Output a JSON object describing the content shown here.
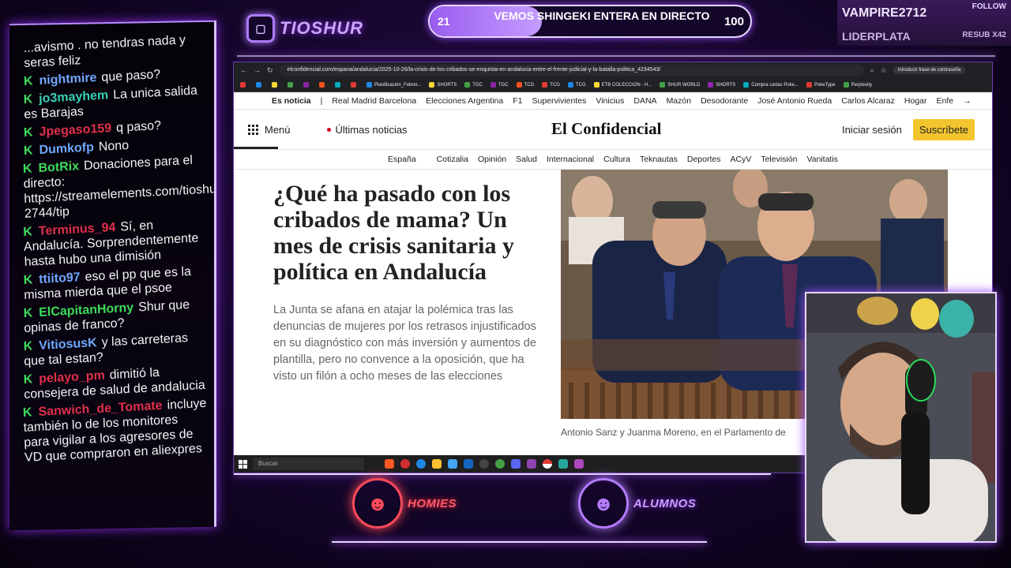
{
  "channel": {
    "name": "TIOSHUR"
  },
  "goal": {
    "current": "21",
    "target": "100",
    "title": "VEMOS SHINGEKI ENTERA EN DIRECTO",
    "progress": 0.21
  },
  "sub_alert": {
    "user": "VAMPIRE2712",
    "follow_label": "FOLLOW",
    "tier": "LIDERPLATA",
    "resub": "RESUB X42"
  },
  "chat": [
    {
      "user": "",
      "color": "",
      "text": "...avismo . no tendras nada y seras feliz",
      "badge": false
    },
    {
      "user": "nightmire",
      "color": "#6fa8ff",
      "text": "que paso?",
      "badge": true
    },
    {
      "user": "jo3mayhem",
      "color": "#3ad0b4",
      "text": "La unica salida es Barajas",
      "badge": true
    },
    {
      "user": "Jpegaso159",
      "color": "#e0304a",
      "text": "q paso?",
      "badge": true
    },
    {
      "user": "Dumkofp",
      "color": "#6fa8ff",
      "text": "Nono",
      "badge": true
    },
    {
      "user": "BotRix",
      "color": "#3ddc5a",
      "text": "Donaciones para el directo: https://streamelements.com/tioshur-2744/tip",
      "badge": true
    },
    {
      "user": "Terminus_94",
      "color": "#e0304a",
      "text": "Sí, en Andalucía. Sorprendentemente hasta hubo una dimisión",
      "badge": true
    },
    {
      "user": "ttiito97",
      "color": "#6fa8ff",
      "text": "eso el pp que es la misma mierda que el psoe",
      "badge": true
    },
    {
      "user": "ElCapitanHorny",
      "color": "#3ddc5a",
      "text": "Shur que opinas de franco?",
      "badge": true
    },
    {
      "user": "VitiosusK",
      "color": "#6fa8ff",
      "text": "y las carreteras que tal estan?",
      "badge": true
    },
    {
      "user": "pelayo_pm",
      "color": "#e0304a",
      "text": "dimitió la consejera de salud de andalucia",
      "badge": true
    },
    {
      "user": "Sanwich_de_Tomate",
      "color": "#e0304a",
      "text": "incluye también lo de los monitores para vigilar a los agresores de VD que compraron en aliexpres",
      "badge": true
    }
  ],
  "browser": {
    "url": "elconfidencial.com/espana/andalucia/2025-10-26/la-crisis-de-los-cribados-se-enquista-en-andalucia-entre-el-frente-judicial-y-la-batalla-politica_4234543/",
    "ext_button": "Introducir frase de contraseña",
    "bookmarks": [
      "Planificación_Febrer...",
      "SHORTS",
      "TGC",
      "TGC",
      "TCG",
      "TCG",
      "TCG",
      "ETB COLECCION - H...",
      "SHUR WORLD",
      "SHORTS",
      "Compra cartas Poke...",
      "PokeType",
      "Perplexity"
    ],
    "bookmark_colors": [
      "#e53935",
      "#1e88e5",
      "#fdd835",
      "#43a047",
      "#8e24aa",
      "#f4511e",
      "#00acc1",
      "#e53935",
      "#1e88e5",
      "#fdd835",
      "#43a047",
      "#8e24aa",
      "#f4511e",
      "#e53935",
      "#1e88e5",
      "#fdd835",
      "#43a047",
      "#8e24aa",
      "#00acc1",
      "#e53935",
      "#43a047"
    ]
  },
  "site": {
    "trending": [
      "Es noticia",
      "|",
      "Real Madrid Barcelona",
      "Elecciones Argentina",
      "F1",
      "Supervivientes",
      "Vinicius",
      "DANA",
      "Mazón",
      "Desodorante",
      "José Antonio Rueda",
      "Carlos Alcaraz",
      "Hogar",
      "Enfe",
      "→"
    ],
    "menu_label": "Menú",
    "latest_label": "Últimas noticias",
    "logo": "El Confidencial",
    "login_label": "Iniciar sesión",
    "subscribe_label": "Suscríbete",
    "sections": [
      "España",
      "Cotizalia",
      "Opinión",
      "Salud",
      "Internacional",
      "Cultura",
      "Teknautas",
      "Deportes",
      "ACyV",
      "Televisión",
      "Vanitatis"
    ]
  },
  "article": {
    "headline": "¿Qué ha pasado con los cribados de mama? Un mes de crisis sanitaria y política en Andalucía",
    "lede": "La Junta se afana en atajar la polémica tras las denuncias de mujeres por los retrasos injustificados en su diagnóstico con más inversión y aumentos de plantilla, pero no convence a la oposición, que ha visto un filón a ocho meses de las elecciones",
    "caption": "Antonio Sanz y Juanma Moreno, en el Parlamento de"
  },
  "taskbar": {
    "search_placeholder": "Buscar"
  },
  "teams": [
    {
      "label": "HOMIES",
      "color": "#ff4a5a"
    },
    {
      "label": "ALUMNOS",
      "color": "#b37bff"
    }
  ]
}
